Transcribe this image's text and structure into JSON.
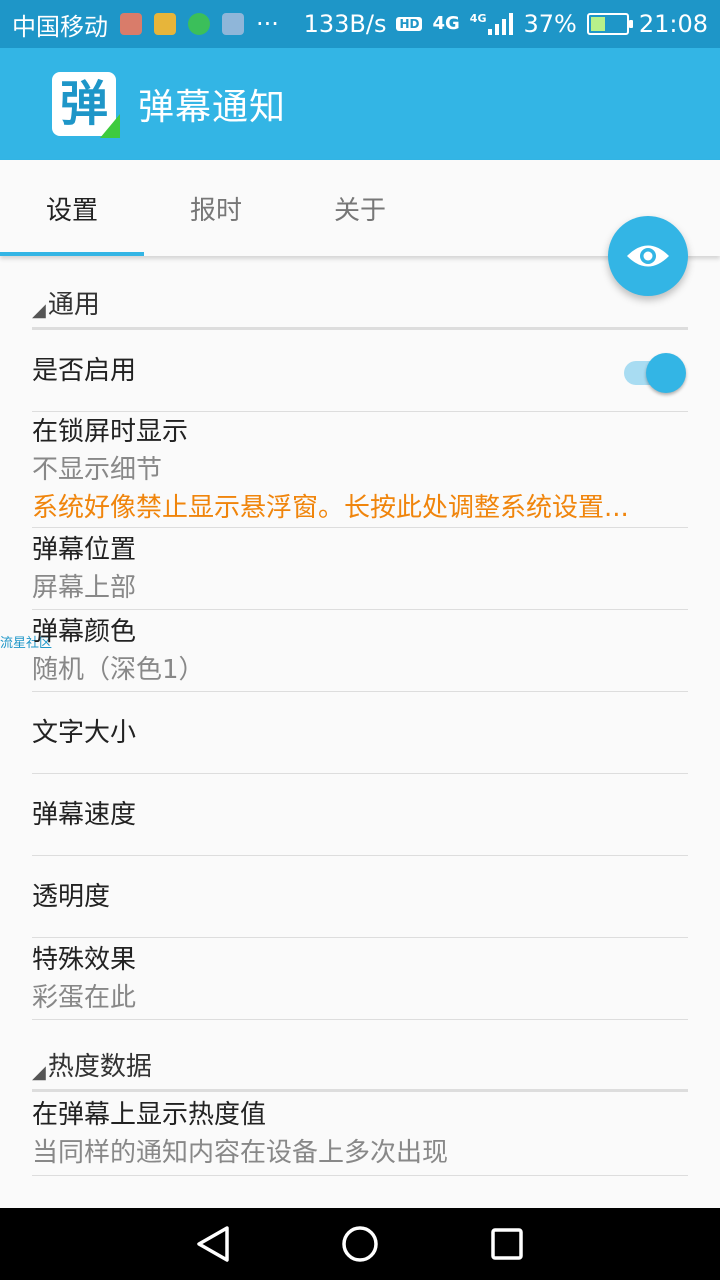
{
  "status_bar": {
    "carrier": "中国移动",
    "more": "···",
    "speed": "133B/s",
    "hd": "HD",
    "net1": "4G",
    "net2": "4G",
    "battery": "37%",
    "time": "21:08",
    "battery_level": 0.37
  },
  "app": {
    "title": "弹幕通知",
    "logo_glyph": "弹"
  },
  "tabs": [
    {
      "label": "设置"
    },
    {
      "label": "报时"
    },
    {
      "label": "关于"
    }
  ],
  "overlay_label": "流星社区",
  "sections": {
    "general": {
      "title": "通用",
      "enable": {
        "title": "是否启用"
      },
      "lockscreen": {
        "title": "在锁屏时显示",
        "summary": "不显示细节",
        "warning": "系统好像禁止显示悬浮窗。长按此处调整系统设置..."
      },
      "position": {
        "title": "弹幕位置",
        "summary": "屏幕上部"
      },
      "color": {
        "title": "弹幕颜色",
        "summary": "随机（深色1）"
      },
      "text_size": {
        "title": "文字大小"
      },
      "speed": {
        "title": "弹幕速度"
      },
      "opacity": {
        "title": "透明度"
      },
      "effects": {
        "title": "特殊效果",
        "summary": "彩蛋在此"
      }
    },
    "heat": {
      "title": "热度数据",
      "show_heat": {
        "title": "在弹幕上显示热度值",
        "summary": "当同样的通知内容在设备上多次出现"
      }
    }
  },
  "colors": {
    "status_bar": "#1e96c8",
    "app_bar": "#33b5e5",
    "accent": "#33b5e5",
    "warning": "#f0850c"
  }
}
